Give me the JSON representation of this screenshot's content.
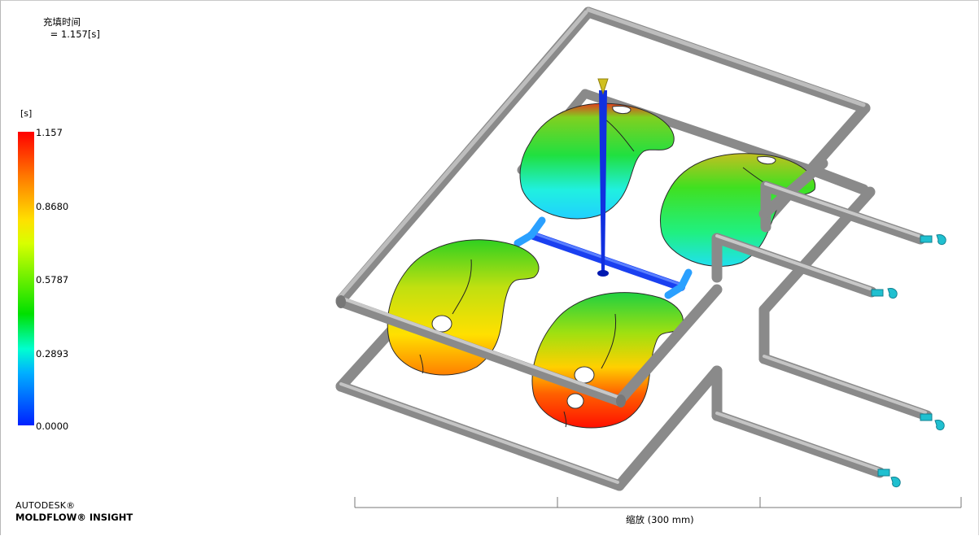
{
  "result": {
    "title": "充填时间",
    "value_text": " = 1.157[s]"
  },
  "legend": {
    "unit": "[s]",
    "ticks": [
      "1.157",
      "0.8680",
      "0.5787",
      "0.2893",
      "0.0000"
    ],
    "max": 1.157,
    "min": 0.0,
    "colors": {
      "max": "#ff0000",
      "high": "#ff7f00",
      "mid_high": "#ffe000",
      "mid": "#00e000",
      "mid_low": "#00ffd0",
      "low": "#00b0ff",
      "min": "#0020ff"
    }
  },
  "brand": {
    "line1": "AUTODESK®",
    "line2": "MOLDFLOW® INSIGHT"
  },
  "scale_bar": {
    "label": "缩放 (300 mm)"
  },
  "scene": {
    "description_icons": [
      "cooling-channel-icon",
      "part-cavity-icon",
      "sprue-icon",
      "runner-icon",
      "inlet-icon"
    ],
    "pipe_color": "#9a9a9a",
    "sprue_color": "#1030e0",
    "runner_color": "#2050ff",
    "inlet_color": "#20c0d0"
  }
}
